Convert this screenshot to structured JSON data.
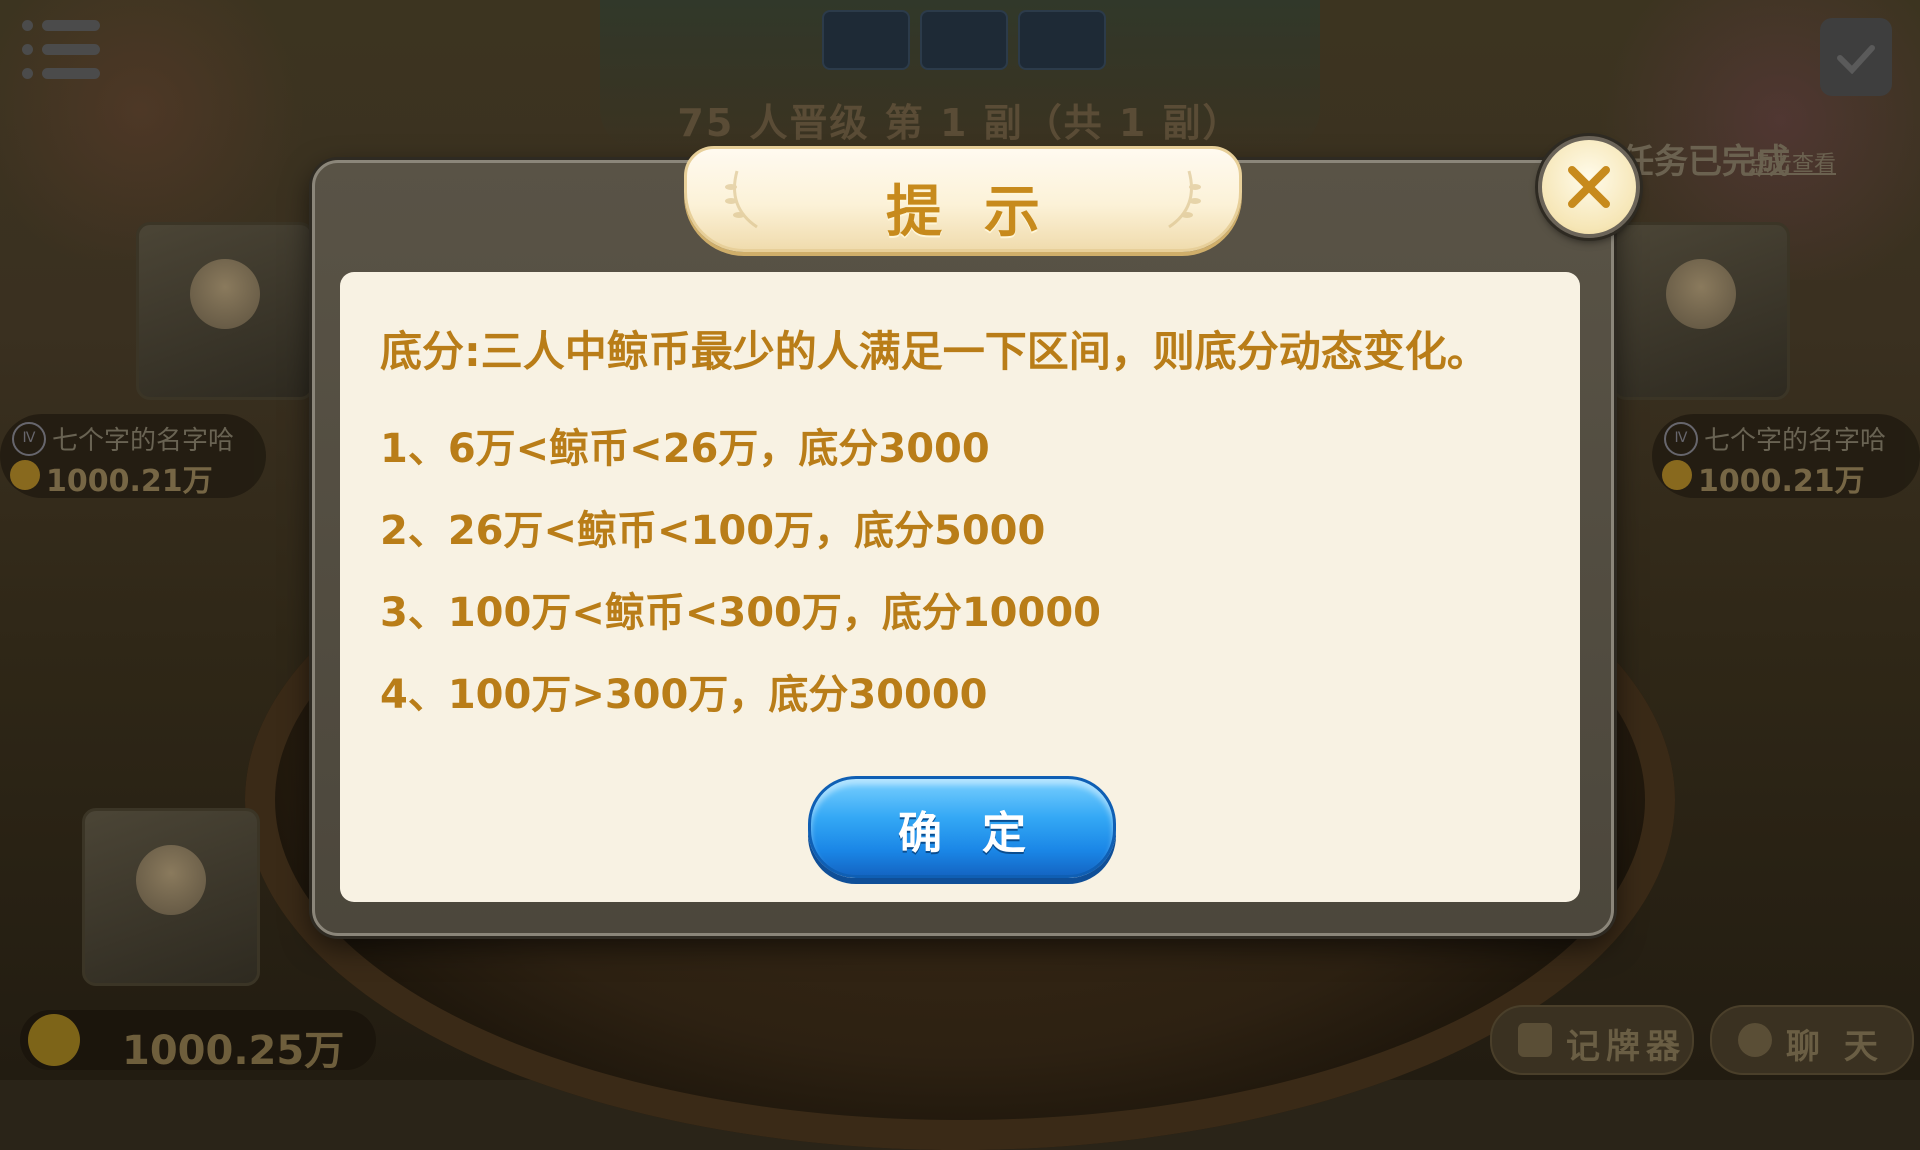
{
  "background": {
    "round_info": "75 人晋级  第 1 副（共 1 副）",
    "task_status": "任务已完成",
    "task_link": "点击查看",
    "players": [
      {
        "level": "Ⅳ",
        "name": "七个字的名字哈",
        "coins": "1000.21万"
      },
      {
        "level": "Ⅳ",
        "name": "七个字的名字哈",
        "coins": "1000.21万"
      }
    ],
    "self_coins": "1000.25万",
    "buttons": {
      "card_counter": "记牌器",
      "chat": "聊 天"
    }
  },
  "dialog": {
    "title": "提示",
    "description": "底分:三人中鲸币最少的人满足一下区间，则底分动态变化。",
    "rules": [
      "1、6万<鲸币<26万，底分3000",
      "2、26万<鲸币<100万，底分5000",
      "3、100万<鲸币<300万，底分10000",
      "4、100万>300万，底分30000"
    ],
    "confirm_label": "确定"
  },
  "colors": {
    "text_gold": "#b97d18",
    "panel_bg": "#f8f2e3",
    "button_blue": "#1a86e6",
    "close_x": "#c78a1c"
  },
  "icons": [
    "menu-icon",
    "calendar-check-icon",
    "close-icon",
    "coin-icon",
    "level-badge-icon",
    "card-counter-icon",
    "chat-icon",
    "laurel-icon"
  ]
}
